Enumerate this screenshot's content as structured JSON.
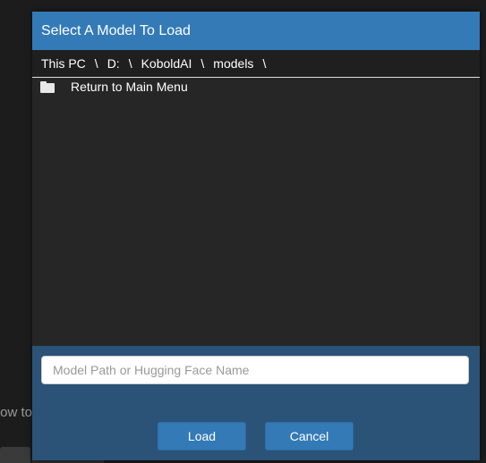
{
  "background": {
    "partial_text": "elow to"
  },
  "modal": {
    "title": "Select A Model To Load",
    "breadcrumb": [
      {
        "label": "This PC"
      },
      {
        "label": "D:"
      },
      {
        "label": "KoboldAI"
      },
      {
        "label": "models"
      }
    ],
    "separator": "\\",
    "files": [
      {
        "label": "Return to Main Menu",
        "icon": "folder-icon"
      }
    ],
    "input": {
      "value": "",
      "placeholder": "Model Path or Hugging Face Name"
    },
    "buttons": {
      "load_label": "Load",
      "cancel_label": "Cancel"
    },
    "colors": {
      "header": "#337ab7",
      "footer": "#2b5277",
      "body": "#262626",
      "button": "#337ab7"
    }
  }
}
